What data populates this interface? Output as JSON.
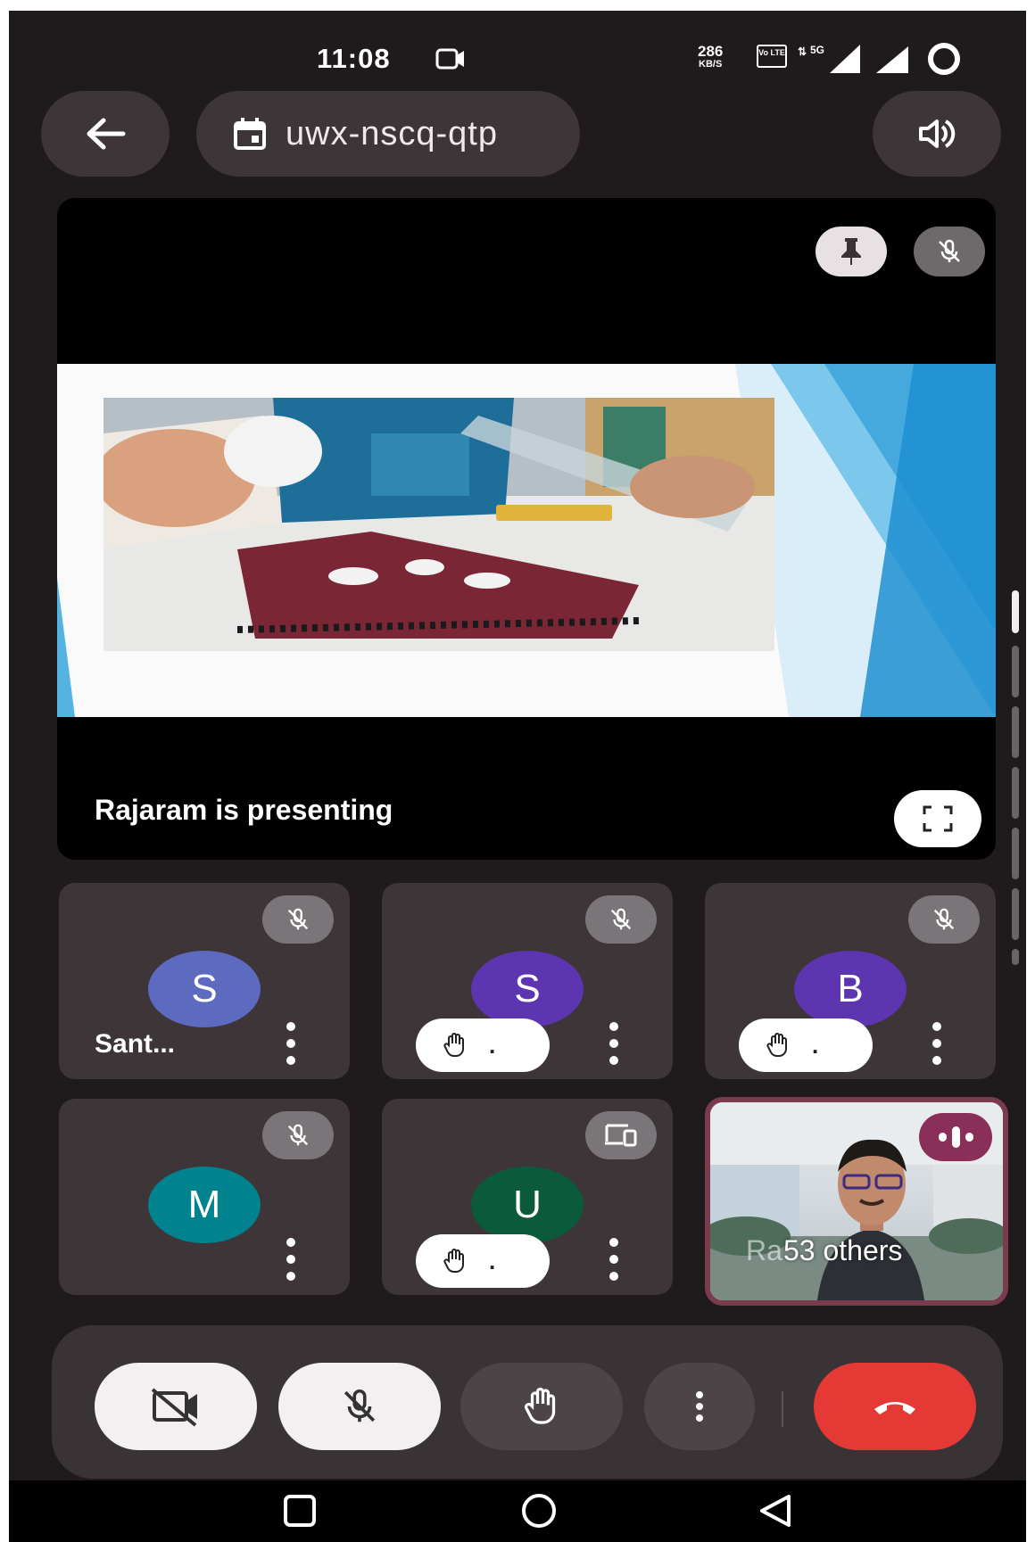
{
  "status_bar": {
    "time": "11:08",
    "net_speed_value": "286",
    "net_speed_unit": "KB/S",
    "lte_label": "Vo LTE",
    "signal_label": "5G"
  },
  "header": {
    "meeting_code": "uwx-nscq-qtp"
  },
  "presentation": {
    "status_text": "Rajaram is presenting"
  },
  "participants": [
    {
      "initial": "S",
      "name": "Sant...",
      "avatar_color": "#5c6bc0",
      "status_icon": "mic-off-icon",
      "hand_raised": false
    },
    {
      "initial": "S",
      "name": "",
      "avatar_color": "#5e35b1",
      "status_icon": "mic-off-icon",
      "hand_raised": true,
      "hand_chip_text": "."
    },
    {
      "initial": "B",
      "name": "",
      "avatar_color": "#5e35b1",
      "status_icon": "mic-off-icon",
      "hand_raised": true,
      "hand_chip_text": "."
    },
    {
      "initial": "M",
      "name": "",
      "avatar_color": "#00838f",
      "status_icon": "mic-off-icon",
      "hand_raised": false
    },
    {
      "initial": "U",
      "name": "",
      "avatar_color": "#0b5a3c",
      "status_icon": "devices-icon",
      "hand_raised": true,
      "hand_chip_text": "."
    }
  ],
  "others_tile": {
    "label": "53 others",
    "ghost_name": "Ra",
    "border_color": "#7a3c4d"
  },
  "colors": {
    "background": "#1f1a1c",
    "surface": "#3d3538",
    "end_call": "#e53935",
    "speaking_chip": "#8a2f58"
  }
}
